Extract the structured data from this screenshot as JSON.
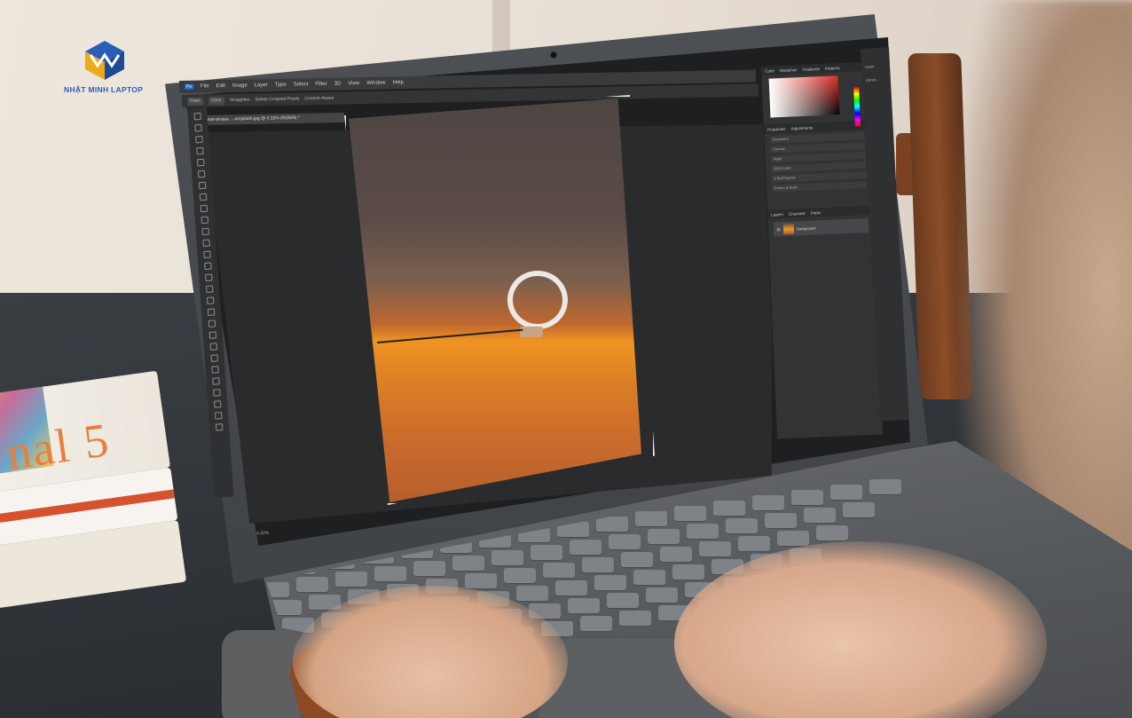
{
  "brand": {
    "name": "NHẬT MINH LAPTOP",
    "colors": {
      "primary": "#2a5eb8",
      "accent": "#f0a81c"
    }
  },
  "book": {
    "title": "nal 5"
  },
  "photoshop": {
    "menu": [
      "File",
      "Edit",
      "Image",
      "Layer",
      "Type",
      "Select",
      "Filter",
      "3D",
      "View",
      "Window",
      "Help"
    ],
    "options": {
      "ratio": "Ratio",
      "clear": "Clear",
      "straighten": "Straighten",
      "delete_cropped": "Delete Cropped Pixels",
      "content_aware": "Content-Aware"
    },
    "document_tab": "anat-anaya-...-unsplash.jpg @ 4.32% (RGB/8) *",
    "status": "4.32%",
    "panels": {
      "top_tabs": [
        "Color",
        "Swatches",
        "Gradients",
        "Patterns"
      ],
      "properties_tabs": [
        "Properties",
        "Adjustments"
      ],
      "properties_rows": [
        "Document",
        "Canvas",
        "Mode",
        "RGB Color",
        "8 Bit/Channel",
        "Rulers & Grids"
      ],
      "layers_tabs": [
        "Layers",
        "Channels",
        "Paths"
      ],
      "layer_name": "Background"
    },
    "side": [
      "Learn",
      "Librari..."
    ]
  }
}
